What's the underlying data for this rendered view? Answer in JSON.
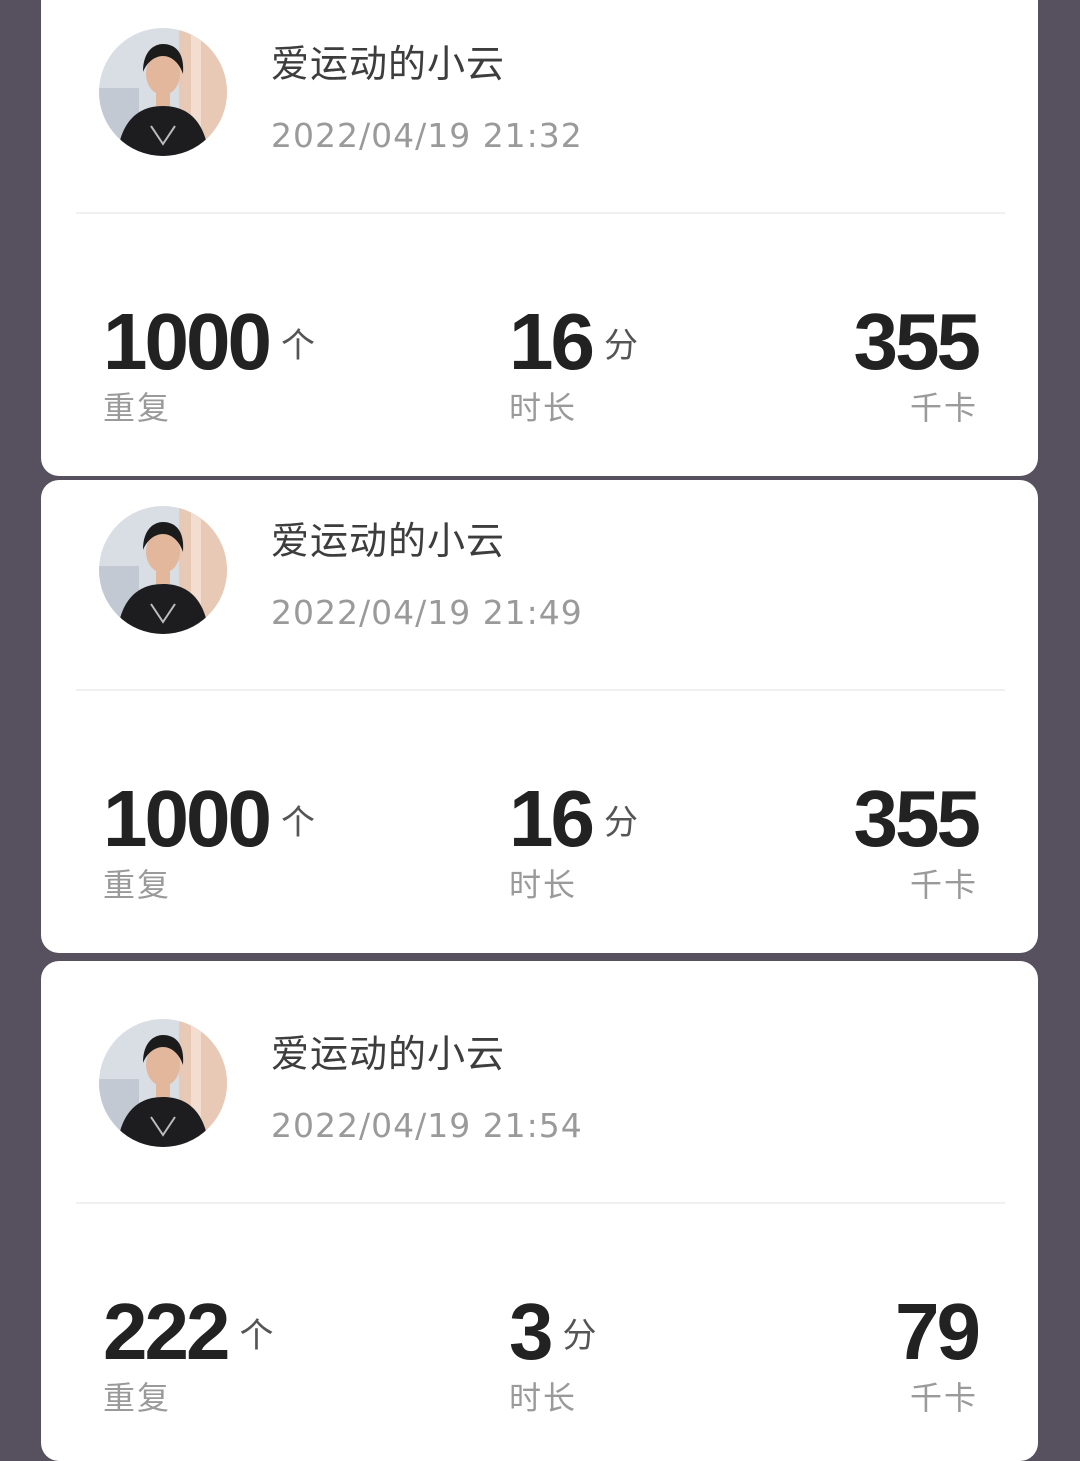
{
  "cards": [
    {
      "username": "爱运动的小云",
      "timestamp": "2022/04/19 21:32",
      "reps": {
        "value": "1000",
        "unit": "个",
        "label": "重复"
      },
      "duration": {
        "value": "16",
        "unit": "分",
        "label": "时长"
      },
      "calories": {
        "value": "355",
        "label": "千卡"
      }
    },
    {
      "username": "爱运动的小云",
      "timestamp": "2022/04/19 21:49",
      "reps": {
        "value": "1000",
        "unit": "个",
        "label": "重复"
      },
      "duration": {
        "value": "16",
        "unit": "分",
        "label": "时长"
      },
      "calories": {
        "value": "355",
        "label": "千卡"
      }
    },
    {
      "username": "爱运动的小云",
      "timestamp": "2022/04/19 21:54",
      "reps": {
        "value": "222",
        "unit": "个",
        "label": "重复"
      },
      "duration": {
        "value": "3",
        "unit": "分",
        "label": "时长"
      },
      "calories": {
        "value": "79",
        "label": "千卡"
      }
    }
  ]
}
